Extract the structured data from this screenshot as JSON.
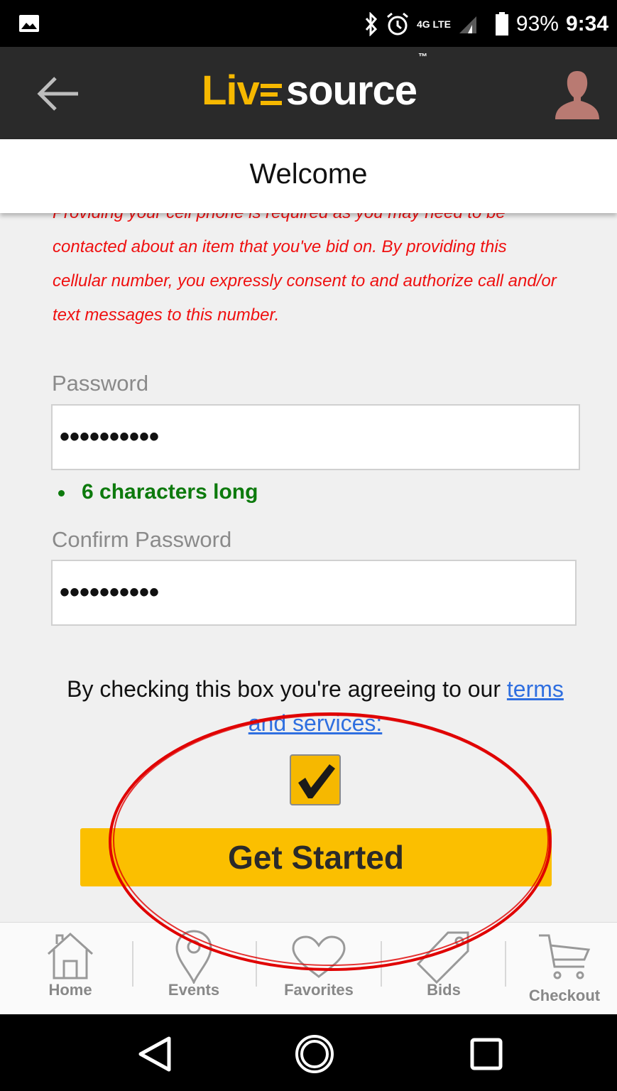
{
  "status_bar": {
    "battery": "93%",
    "time": "9:34",
    "network": "4G LTE",
    "icons": [
      "image-icon",
      "bluetooth-icon",
      "alarm-icon",
      "signal-icon",
      "battery-icon"
    ]
  },
  "app_bar": {
    "logo_part1": "Liv",
    "logo_part2": "source",
    "logo_tm": "™",
    "back_icon": "arrow-left-icon",
    "profile_icon": "user-avatar-icon"
  },
  "header": {
    "title": "Welcome"
  },
  "form": {
    "disclaimer": "Providing your cell phone is required as you may need to be contacted about an item that you've bid on. By providing this cellular number, you expressly consent to and authorize call and/or text messages to this number.",
    "password_label": "Password",
    "password_value": "••••••••••",
    "password_rule": "6 characters long",
    "confirm_label": "Confirm Password",
    "confirm_value": "••••••••••",
    "agree_text": "By checking this box you're agreeing to our ",
    "terms_link": "terms and services:",
    "agree_checked": true,
    "submit_label": "Get Started"
  },
  "tabs": [
    {
      "label": "Home",
      "icon": "home-icon"
    },
    {
      "label": "Events",
      "icon": "map-pin-icon"
    },
    {
      "label": "Favorites",
      "icon": "heart-icon"
    },
    {
      "label": "Bids",
      "icon": "tag-icon"
    },
    {
      "label": "Checkout",
      "icon": "cart-icon"
    }
  ],
  "nav_bar": {
    "icons": [
      "back-triangle-icon",
      "home-circle-icon",
      "recents-square-icon"
    ]
  },
  "colors": {
    "accent": "#fbbf00",
    "error": "#ef1010",
    "success": "#0d7a0d",
    "link": "#2f6fe0",
    "annotation": "#e00000"
  }
}
